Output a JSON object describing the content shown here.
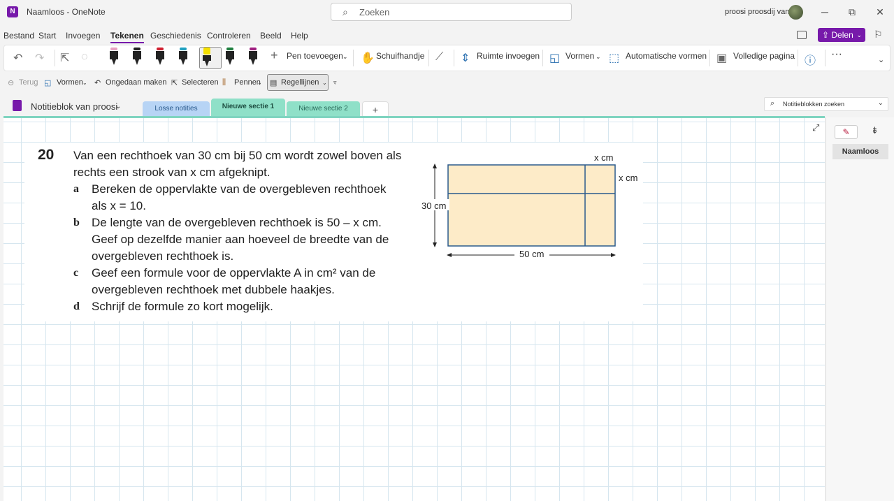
{
  "titlebar": {
    "app_logo": "N",
    "title": "Naamloos  -  OneNote",
    "search_placeholder": "Zoeken",
    "user_name": "proosi proosdij van",
    "minimize": "─",
    "restore": "⧉",
    "close": "✕"
  },
  "menu": {
    "items": [
      "Bestand",
      "Start",
      "Invoegen",
      "Tekenen",
      "Geschiedenis",
      "Controleren",
      "Beeld",
      "Help"
    ],
    "active": "Tekenen",
    "share_label": "Delen"
  },
  "ribbon": {
    "pens": [
      {
        "cap": "#e8a0c0"
      },
      {
        "cap": "#222222"
      },
      {
        "cap": "#d02030"
      },
      {
        "cap": "#20a0c0"
      },
      {
        "cap": "#f5e000"
      },
      {
        "cap": "#208040"
      },
      {
        "cap": "#a02080"
      }
    ],
    "add_pen": "Pen toevoegen",
    "hand": "Schuifhandje",
    "insert_space": "Ruimte invoegen",
    "shapes": "Vormen",
    "auto_shapes": "Automatische vormen",
    "full_page": "Volledige pagina",
    "more": "···"
  },
  "subbar": {
    "back": "Terug",
    "shapes": "Vormen",
    "undo": "Ongedaan maken",
    "select": "Selecteren",
    "pens": "Pennen",
    "rule_lines": "Regellijnen"
  },
  "notebook": {
    "name": "Notitieblok van proosi",
    "tabs": [
      {
        "label": "Losse notities",
        "color": "#b7d4f5"
      },
      {
        "label": "Nieuwe sectie 1",
        "color": "#8fe0c8"
      },
      {
        "label": "Nieuwe sectie 2",
        "color": "#8fe0c8"
      }
    ],
    "add_tab": "+",
    "search_placeholder": "Notitieblokken zoeken"
  },
  "pages": {
    "items": [
      "Naamloos"
    ]
  },
  "exercise": {
    "number": "20",
    "intro_1": "Van een rechthoek van 30 cm bij 50 cm wordt zowel boven als",
    "intro_2": "rechts een strook van x cm afgeknipt.",
    "a_letter": "a",
    "a_1": "Bereken de oppervlakte van de overgebleven rechthoek",
    "a_2": "als x = 10.",
    "b_letter": "b",
    "b_1": "De lengte van de overgebleven rechthoek is 50 – x cm.",
    "b_2": "Geef op dezelfde manier aan hoeveel de breedte van de",
    "b_3": "overgebleven rechthoek is.",
    "c_letter": "c",
    "c_1": "Geef een formule voor de oppervlakte A in cm² van de",
    "c_2": "overgebleven rechthoek met dubbele haakjes.",
    "d_letter": "d",
    "d_1": "Schrijf de formule zo kort mogelijk.",
    "figure": {
      "top_label": "x cm",
      "right_label": "x cm",
      "left_label": "30 cm",
      "bottom_label": "50 cm",
      "fill": "#fdebc8",
      "stroke": "#2a5a8c"
    }
  }
}
